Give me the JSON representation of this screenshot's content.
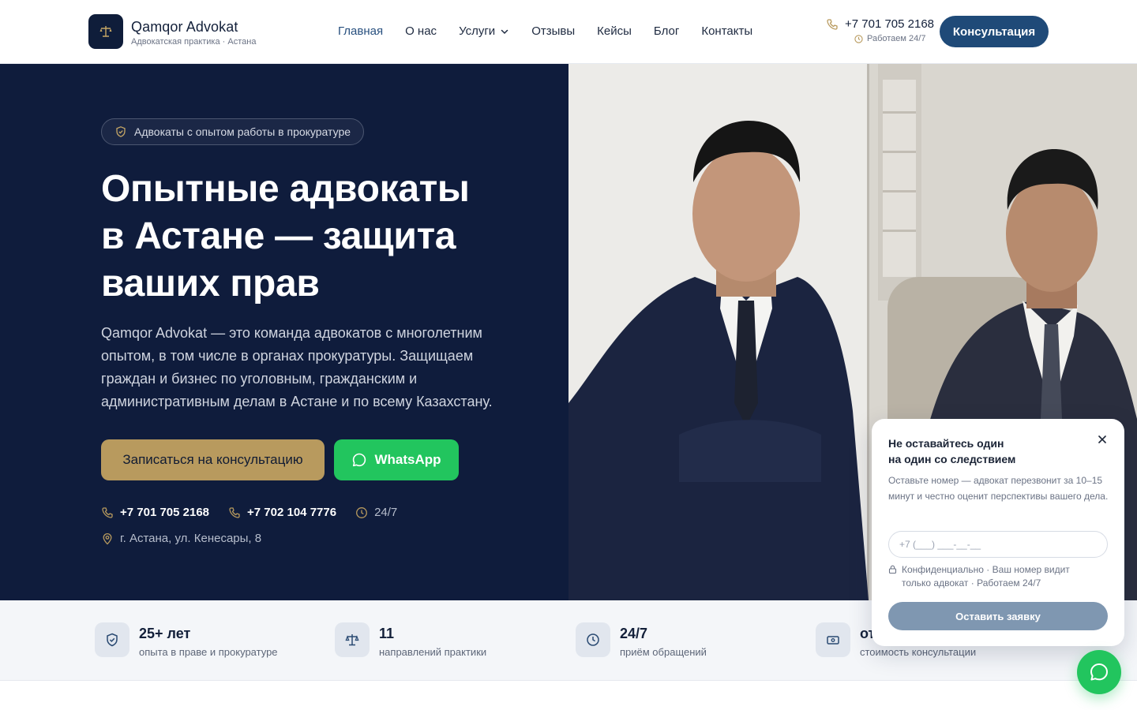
{
  "brand": {
    "name": "Qamqor Advokat",
    "subtitle": "Адвокатская практика · Астана"
  },
  "nav": {
    "items": [
      {
        "label": "Главная",
        "active": true
      },
      {
        "label": "О нас"
      },
      {
        "label": "Услуги",
        "dropdown": true
      },
      {
        "label": "Отзывы"
      },
      {
        "label": "Кейсы"
      },
      {
        "label": "Блог"
      },
      {
        "label": "Контакты"
      }
    ]
  },
  "header": {
    "phone": "+7 701 705 2168",
    "hours": "Работаем 24/7",
    "cta_label": "Консультация"
  },
  "hero": {
    "badge": "Адвокаты с опытом работы в прокуратуре",
    "title_lines": [
      "Опытные адвокаты",
      "в Астане — защита",
      "ваших прав"
    ],
    "description": "Qamqor Advokat — это команда адвокатов с многолетним опытом, в том числе в органах прокуратуры. Защищаем граждан и бизнес по уголовным, гражданским и административным делам в Астане и по всему Казахстану.",
    "primary_button": "Записаться на консультацию",
    "whatsapp_button": "WhatsApp",
    "phone_1": "+7 701 705 2168",
    "phone_2": "+7 702 104 7776",
    "availability": "24/7",
    "address": "г. Астана, ул. Кенесары, 8"
  },
  "stats": [
    {
      "value": "25+ лет",
      "label": "опыта в праве и прокуратуре",
      "icon": "shield-icon"
    },
    {
      "value": "11",
      "label": "направлений практики",
      "icon": "scales-icon"
    },
    {
      "value": "24/7",
      "label": "приём обращений",
      "icon": "clock-icon"
    },
    {
      "value": "от",
      "label": "стоимость консультации",
      "icon": "money-icon"
    }
  ],
  "popup": {
    "title_lines": [
      "Не оставайтесь один",
      "на один со следствием"
    ],
    "text": "Оставьте номер — адвокат перезвонит за 10–15 минут и честно оценит перспективы вашего дела.",
    "phone_placeholder": "+7 (___) ___-__-__",
    "privacy_note": "Конфиденциально · Ваш номер видит только адвокат · Работаем 24/7",
    "submit_label": "Оставить заявку"
  },
  "colors": {
    "navy": "#0f1c3c",
    "gold": "#b89a5e",
    "whatsapp": "#22c55e",
    "button_blue": "#1f4a78"
  }
}
